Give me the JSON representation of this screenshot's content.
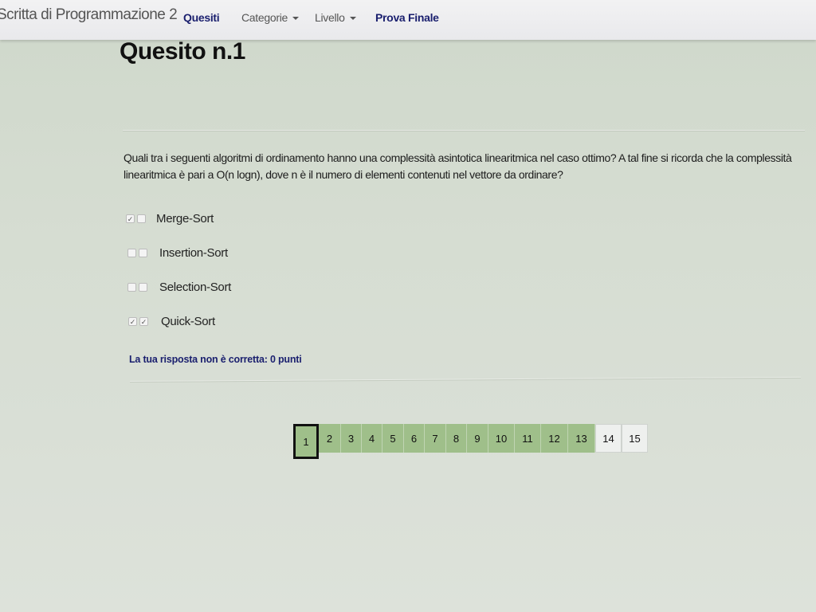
{
  "navbar": {
    "brand": "Scritta di Programmazione 2",
    "items": [
      {
        "label": "Quesiti",
        "active": true,
        "dropdown": false
      },
      {
        "label": "Categorie",
        "active": false,
        "dropdown": true
      },
      {
        "label": "Livello",
        "active": false,
        "dropdown": true
      },
      {
        "label": "Prova Finale",
        "active": true,
        "dropdown": false
      }
    ]
  },
  "question": {
    "title": "Quesito n.1",
    "text": "Quali tra i seguenti algoritmi di ordinamento hanno una complessità asintotica linearitmica nel caso ottimo? A tal fine si ricorda che la complessità linearitmica è pari a O(n logn), dove n è il numero di elementi contenuti nel vettore da ordinare?",
    "options": [
      {
        "label": "Merge-Sort",
        "check_a": true,
        "check_b": false
      },
      {
        "label": "Insertion-Sort",
        "check_a": false,
        "check_b": false
      },
      {
        "label": "Selection-Sort",
        "check_a": false,
        "check_b": false
      },
      {
        "label": "Quick-Sort",
        "check_a": true,
        "check_b": true
      }
    ],
    "feedback": "La tua risposta non è corretta: 0 punti"
  },
  "pagination": {
    "current": "1",
    "pages": [
      "1",
      "2",
      "3",
      "4",
      "5",
      "6",
      "7",
      "8",
      "9",
      "10",
      "11",
      "12",
      "13",
      "14",
      "15"
    ],
    "answered_count": 13,
    "colors": {
      "answered": "#9fbf8a",
      "unanswered": "#eef0ee",
      "current_border": "#111111"
    }
  },
  "colors": {
    "accent": "#1a1f6e",
    "background": "#d6ddd2",
    "navbar": "#eeeeef"
  },
  "icons": {
    "checkmark": "check-icon",
    "dropdown": "caret-down-icon"
  }
}
